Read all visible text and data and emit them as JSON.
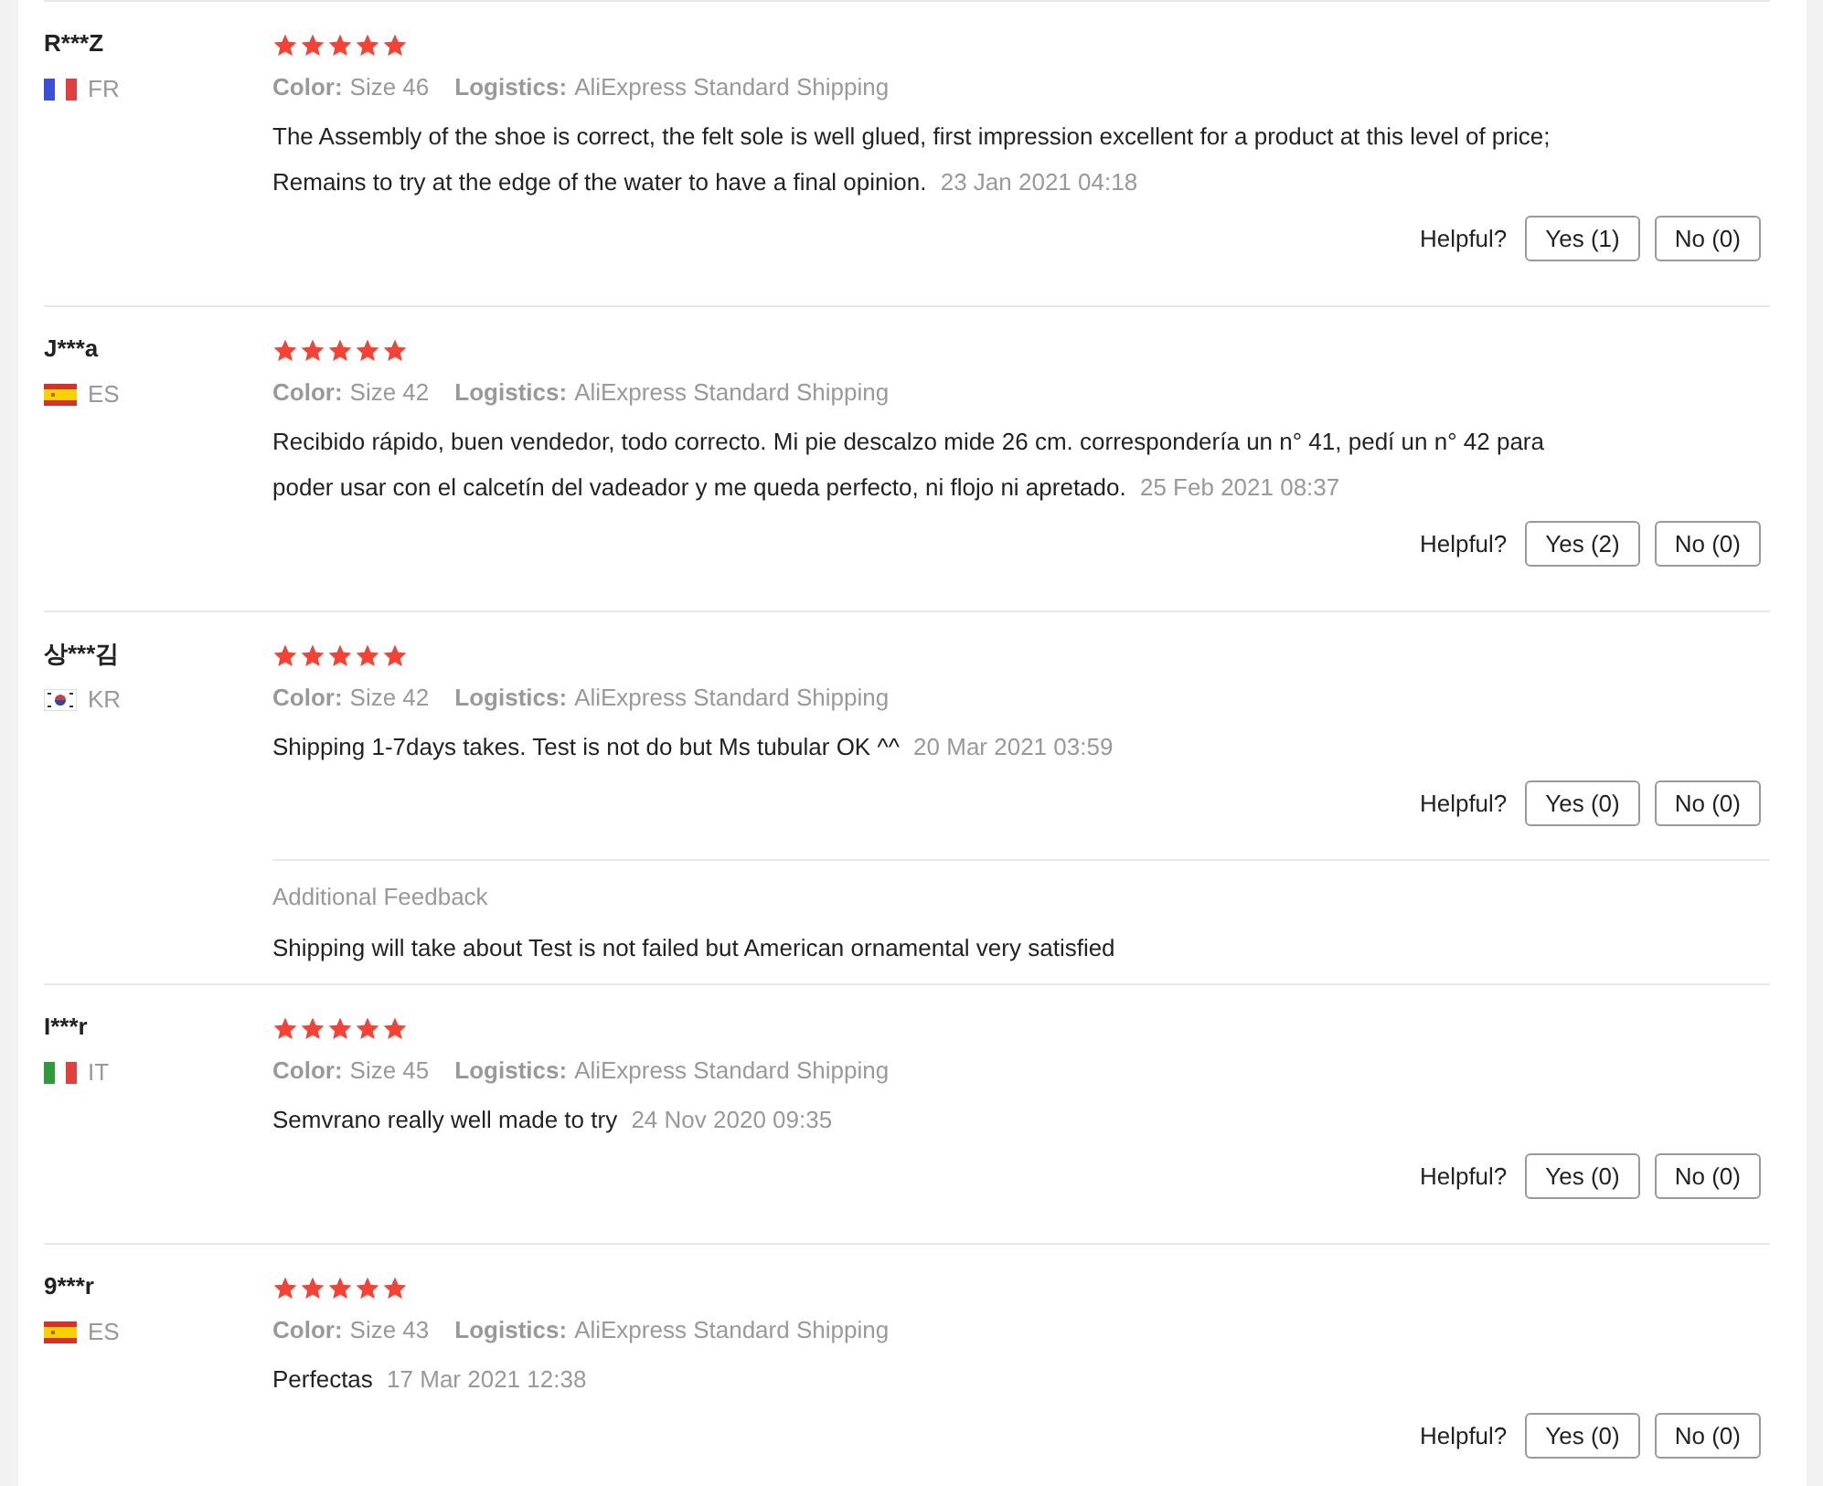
{
  "reviews": [
    {
      "name": "R***Z",
      "country": {
        "kind": "fr",
        "code": "FR"
      },
      "stars": 5,
      "attributes": [
        {
          "label": "Color:",
          "value": "Size 46"
        },
        {
          "label": "Logistics:",
          "value": "AliExpress Standard Shipping"
        }
      ],
      "text": "The Assembly of the shoe is correct, the felt sole is well glued, first impression excellent for a product at this level of price; Remains to try at the edge of the water to have a final opinion.",
      "date": "23 Jan 2021 04:18",
      "helpful_label": "Helpful?",
      "yes_button": "Yes (1)",
      "no_button": "No (0)"
    },
    {
      "name": "J***a",
      "country": {
        "kind": "es",
        "code": "ES"
      },
      "stars": 5,
      "attributes": [
        {
          "label": "Color:",
          "value": "Size 42"
        },
        {
          "label": "Logistics:",
          "value": "AliExpress Standard Shipping"
        }
      ],
      "text": "Recibido rápido, buen vendedor, todo correcto. Mi pie descalzo mide 26 cm. correspondería un n° 41, pedí un n° 42 para poder usar con el calcetín del vadeador y me queda perfecto, ni flojo ni apretado.",
      "date": "25 Feb 2021 08:37",
      "helpful_label": "Helpful?",
      "yes_button": "Yes (2)",
      "no_button": "No (0)"
    },
    {
      "name": "상***김",
      "country": {
        "kind": "kr",
        "code": "KR"
      },
      "stars": 5,
      "attributes": [
        {
          "label": "Color:",
          "value": "Size 42"
        },
        {
          "label": "Logistics:",
          "value": "AliExpress Standard Shipping"
        }
      ],
      "text": "Shipping 1-7days takes. Test is not do but Ms tubular OK ^^",
      "date": "20 Mar 2021 03:59",
      "helpful_label": "Helpful?",
      "yes_button": "Yes (0)",
      "no_button": "No (0)",
      "additional_feedback": {
        "title": "Additional Feedback",
        "text": "Shipping will take about Test is not failed but American ornamental very satisfied"
      }
    },
    {
      "name": "I***r",
      "country": {
        "kind": "it",
        "code": "IT"
      },
      "stars": 5,
      "attributes": [
        {
          "label": "Color:",
          "value": "Size 45"
        },
        {
          "label": "Logistics:",
          "value": "AliExpress Standard Shipping"
        }
      ],
      "text": "Semvrano really well made to try",
      "date": "24 Nov 2020 09:35",
      "helpful_label": "Helpful?",
      "yes_button": "Yes (0)",
      "no_button": "No (0)"
    },
    {
      "name": "9***r",
      "country": {
        "kind": "es",
        "code": "ES"
      },
      "stars": 5,
      "attributes": [
        {
          "label": "Color:",
          "value": "Size 43"
        },
        {
          "label": "Logistics:",
          "value": "AliExpress Standard Shipping"
        }
      ],
      "text": "Perfectas",
      "date": "17 Mar 2021 12:38",
      "helpful_label": "Helpful?",
      "yes_button": "Yes (0)",
      "no_button": "No (0)"
    }
  ]
}
